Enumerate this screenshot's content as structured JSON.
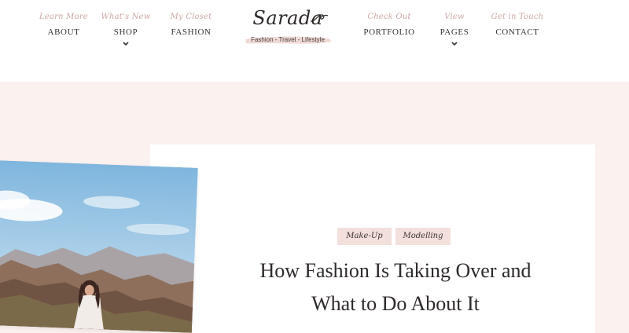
{
  "nav": {
    "left": [
      {
        "sub": "Learn More",
        "label": "ABOUT",
        "has_dropdown": false
      },
      {
        "sub": "What's New",
        "label": "SHOP",
        "has_dropdown": true
      },
      {
        "sub": "My Closet",
        "label": "FASHION",
        "has_dropdown": false
      }
    ],
    "right": [
      {
        "sub": "Check Out",
        "label": "PORTFOLIO",
        "has_dropdown": false
      },
      {
        "sub": "View",
        "label": "PAGES",
        "has_dropdown": true
      },
      {
        "sub": "Get in Touch",
        "label": "CONTACT",
        "has_dropdown": false
      }
    ]
  },
  "logo": {
    "name": "Sarada",
    "tagline": "Fashion - Travel - Lifestyle"
  },
  "post": {
    "tags": [
      "Make-Up",
      "Modelling"
    ],
    "title_line1": "How Fashion Is Taking Over and",
    "title_line2": "What to Do About It"
  },
  "colors": {
    "page_bg": "#fbf1ef",
    "tag_bg": "#f3dfdc",
    "nav_sub": "#c9a8a4",
    "text_dark": "#2f2a2a"
  }
}
